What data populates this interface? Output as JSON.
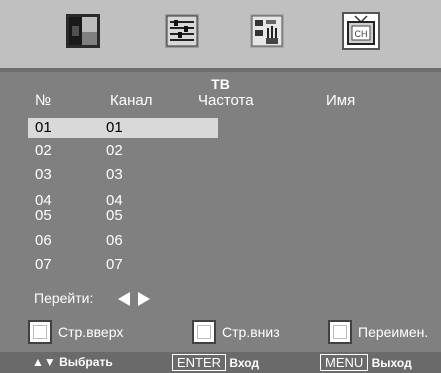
{
  "menu": {
    "icons": [
      {
        "name": "picture-icon",
        "active": false
      },
      {
        "name": "sound-icon",
        "active": false
      },
      {
        "name": "setup-icon",
        "active": false
      },
      {
        "name": "channel-icon",
        "active": true,
        "text": "CH"
      }
    ]
  },
  "screen": {
    "title": "ТВ",
    "columns": {
      "num": "№",
      "channel": "Канал",
      "freq": "Частота",
      "name": "Имя"
    },
    "rows": [
      {
        "num": "01",
        "ch": "01",
        "selected": true
      },
      {
        "num": "02",
        "ch": "02",
        "selected": false
      },
      {
        "num": "03",
        "ch": "03",
        "selected": false
      },
      {
        "num": "04",
        "ch": "04",
        "selected": false
      },
      {
        "num": "05",
        "ch": "05",
        "selected": false
      },
      {
        "num": "06",
        "ch": "06",
        "selected": false
      },
      {
        "num": "07",
        "ch": "07",
        "selected": false
      }
    ],
    "goto_label": "Перейти:"
  },
  "function_buttons": {
    "page_up": "Стр.вверх",
    "page_down": "Стр.вниз",
    "rename": "Переимен."
  },
  "status_bar": {
    "select_arrows": "▲▼",
    "select_label": "Выбрать",
    "enter_key": "ENTER",
    "enter_label": "Вход",
    "menu_key": "MENU",
    "menu_label": "Выход"
  },
  "colors": {
    "background": "#808080",
    "icon_bar": "#c0c0c0",
    "selection": "#d9d9d9",
    "status_bar": "#6a6a6a"
  }
}
